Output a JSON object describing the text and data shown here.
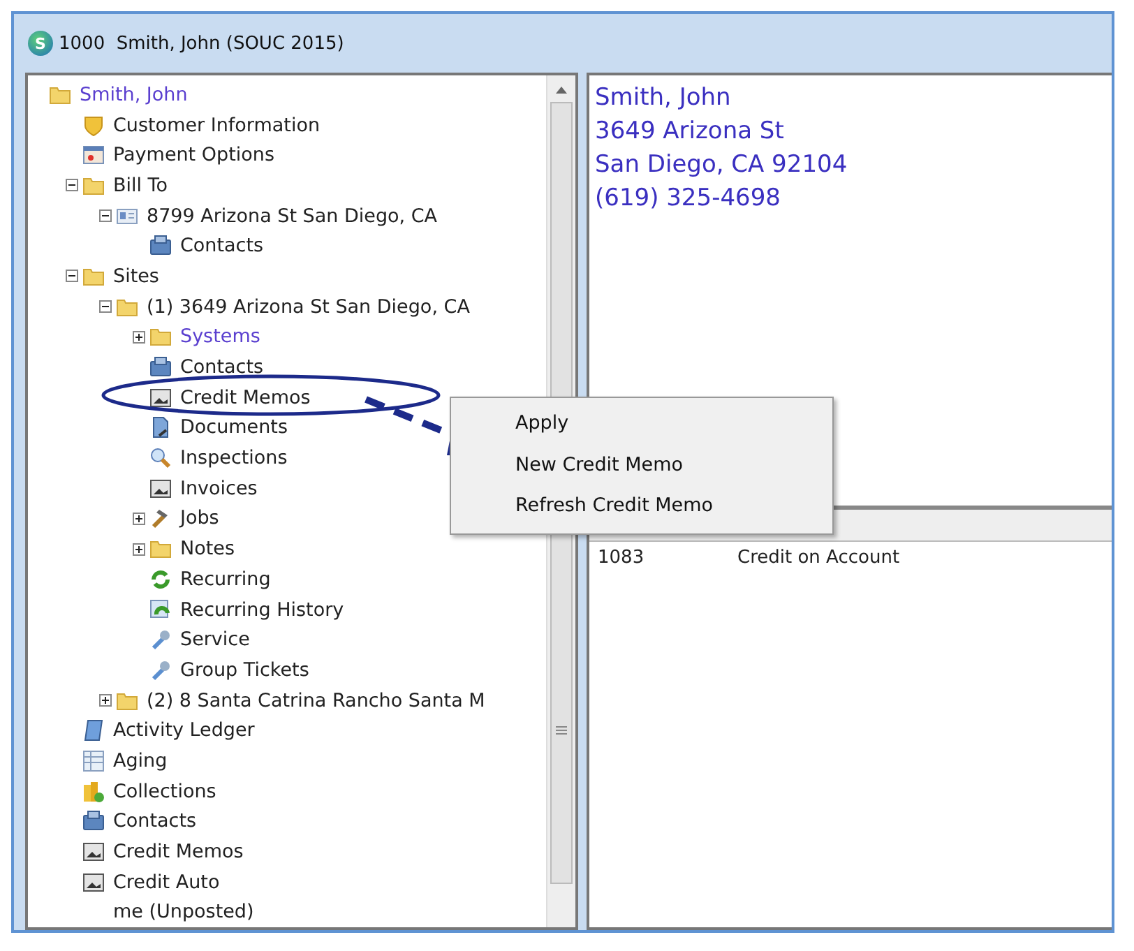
{
  "window": {
    "logo_letter": "S",
    "title": "1000  Smith, John (SOUC 2015)"
  },
  "tree": [
    {
      "label": "Smith, John",
      "kind": "folder",
      "color": "#5a3fcf",
      "children": [
        {
          "label": "Customer Information",
          "kind": "shield"
        },
        {
          "label": "Payment Options",
          "kind": "card"
        },
        {
          "label": "Bill To",
          "kind": "folder",
          "expanded": true,
          "children": [
            {
              "label": "8799 Arizona St San Diego, CA",
              "kind": "idcard",
              "expanded": true,
              "children": [
                {
                  "label": "Contacts",
                  "kind": "rolodex"
                }
              ]
            }
          ]
        },
        {
          "label": "Sites",
          "kind": "folder",
          "expanded": true,
          "children": [
            {
              "label": "(1) 3649 Arizona St San Diego, CA",
              "kind": "folder",
              "expanded": true,
              "children": [
                {
                  "label": "Systems",
                  "kind": "folder",
                  "expanded": false,
                  "color": "#5a3fcf"
                },
                {
                  "label": "Contacts",
                  "kind": "rolodex"
                },
                {
                  "label": "Credit Memos",
                  "kind": "frame"
                },
                {
                  "label": "Documents",
                  "kind": "document"
                },
                {
                  "label": "Inspections",
                  "kind": "magnifier"
                },
                {
                  "label": "Invoices",
                  "kind": "frame"
                },
                {
                  "label": "Jobs",
                  "kind": "hammer",
                  "expanded": false
                },
                {
                  "label": "Notes",
                  "kind": "folder",
                  "expanded": false
                },
                {
                  "label": "Recurring",
                  "kind": "recycle"
                },
                {
                  "label": "Recurring History",
                  "kind": "history"
                },
                {
                  "label": "Service",
                  "kind": "wrench"
                },
                {
                  "label": "Group Tickets",
                  "kind": "wrench"
                }
              ]
            },
            {
              "label": "(2) 8 Santa Catrina Rancho Santa M",
              "kind": "folder",
              "expanded": false
            }
          ]
        },
        {
          "label": "Activity Ledger",
          "kind": "notebook"
        },
        {
          "label": "Aging",
          "kind": "sheet"
        },
        {
          "label": "Collections",
          "kind": "coins"
        },
        {
          "label": "Contacts",
          "kind": "rolodex"
        },
        {
          "label": "Credit Memos",
          "kind": "frame"
        },
        {
          "label": "Credit Auto",
          "kind": "frame"
        },
        {
          "label": "me (Unposted)",
          "kind": "none"
        }
      ]
    }
  ],
  "info_lines": [
    "Smith, John",
    "3649 Arizona St",
    "San Diego, CA 92104",
    "(619) 325-4698"
  ],
  "grid": {
    "rows": [
      [
        "1083",
        "Credit on Account"
      ]
    ]
  },
  "context_menu": [
    "Apply",
    "New Credit Memo",
    "Refresh Credit Memo"
  ]
}
